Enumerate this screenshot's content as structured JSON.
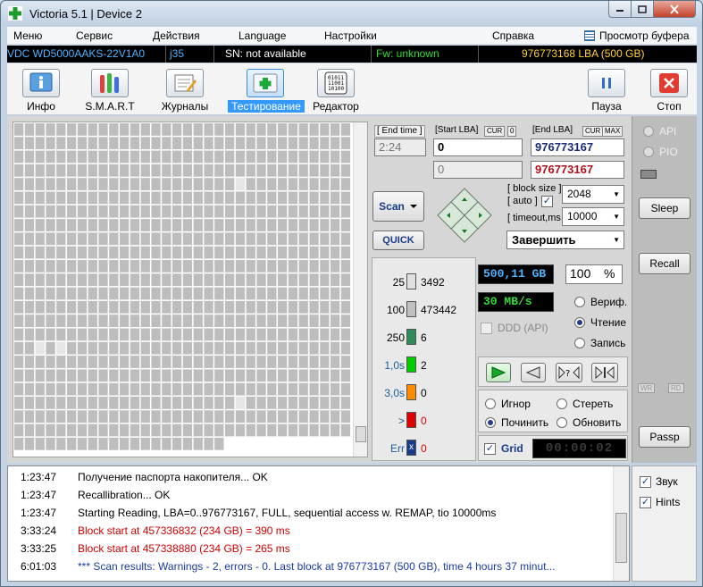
{
  "window": {
    "title": "Victoria 5.1 | Device 2",
    "accent": "#3399ff"
  },
  "menu": [
    "Меню",
    "Сервис",
    "Действия",
    "Language",
    "Настройки",
    "Справка"
  ],
  "menu_buffer": "Просмотр буфера",
  "infobar": {
    "model": "VDC WD5000AAKS-22V1A0",
    "port": "j35",
    "serial": "SN: not available",
    "firmware": "Fw: unknown",
    "lba": "976773168 LBA (500 GB)"
  },
  "toolbar": [
    {
      "label": "Инфо",
      "icon": "info-icon"
    },
    {
      "label": "S.M.A.R.T",
      "icon": "smart-icon"
    },
    {
      "label": "Журналы",
      "icon": "logs-icon"
    },
    {
      "label": "Тестирование",
      "icon": "test-icon"
    },
    {
      "label": "Редактор",
      "icon": "editor-icon"
    },
    {
      "label": "Пауза",
      "icon": "pause-icon"
    },
    {
      "label": "Стоп",
      "icon": "stop-icon"
    }
  ],
  "scan": {
    "end_time_label": "[ End time ]",
    "end_time": "2:24",
    "start_lba_label": "[Start LBA]",
    "cur_label": "CUR",
    "zero_label": "0",
    "end_lba_label": "[End LBA]",
    "max_label": "MAX",
    "start_lba": "0",
    "end_lba": "976773167",
    "cur_lba": "0",
    "end_lba_2": "976773167",
    "scan_btn": "Scan",
    "quick_btn": "QUICK",
    "block_size_label": "[ block size ]",
    "auto_label": "[ auto ]",
    "block_size": "2048",
    "timeout_label": "[ timeout,ms ]",
    "timeout": "10000",
    "finish": "Завершить"
  },
  "stats": [
    {
      "label": "25",
      "value": "3492",
      "color": "#e0e0e0",
      "label_color": "#000"
    },
    {
      "label": "100",
      "value": "473442",
      "color": "#c0c0c0",
      "label_color": "#000"
    },
    {
      "label": "250",
      "value": "6",
      "color": "#2e8b57",
      "label_color": "#000"
    },
    {
      "label": "1,0s",
      "value": "2",
      "color": "#00cc00",
      "label_color": "#1a5e9a"
    },
    {
      "label": "3,0s",
      "value": "0",
      "color": "#ff8c00",
      "label_color": "#1a5e9a"
    },
    {
      "label": ">",
      "value": "0",
      "color": "#e00000",
      "label_color": "#1a5e9a"
    },
    {
      "label": "Err",
      "value": "0",
      "color": "#1a3a8a",
      "label_color": "#1a5e9a"
    }
  ],
  "readouts": {
    "size": "500,11 GB",
    "percent": "100",
    "percent_sign": "%",
    "speed": "30 MB/s",
    "ddd_label": "DDD (API)",
    "timer": "00:00:02"
  },
  "modes": {
    "verify": "Вериф.",
    "read": "Чтение",
    "write": "Запись"
  },
  "actions": {
    "ignore": "Игнор",
    "erase": "Стереть",
    "repair": "Починить",
    "refresh": "Обновить"
  },
  "grid_label": "Grid",
  "side": {
    "api": "API",
    "pio": "PIO",
    "sleep": "Sleep",
    "recall": "Recall",
    "wr": "WR",
    "rd": "RD",
    "passp": "Passp",
    "sound": "Звук",
    "hints": "Hints"
  },
  "log": [
    {
      "time": "1:23:47",
      "text": "Получение паспорта накопителя... OK",
      "color": "#000000"
    },
    {
      "time": "1:23:47",
      "text": "Recallibration... OK",
      "color": "#000000"
    },
    {
      "time": "1:23:47",
      "text": "Starting Reading, LBA=0..976773167, FULL, sequential access w. REMAP, tio 10000ms",
      "color": "#000000"
    },
    {
      "time": "3:33:24",
      "text": "Block start at 457336832 (234 GB)  = 390 ms",
      "color": "#d00000"
    },
    {
      "time": "3:33:25",
      "text": "Block start at 457338880 (234 GB)  = 265 ms",
      "color": "#d00000"
    },
    {
      "time": "6:01:03",
      "text": "*** Scan results: Warnings - 2, errors - 0. Last block at 976773167 (500 GB), time 4 hours 37 minut...",
      "color": "#1a3aa0"
    }
  ]
}
